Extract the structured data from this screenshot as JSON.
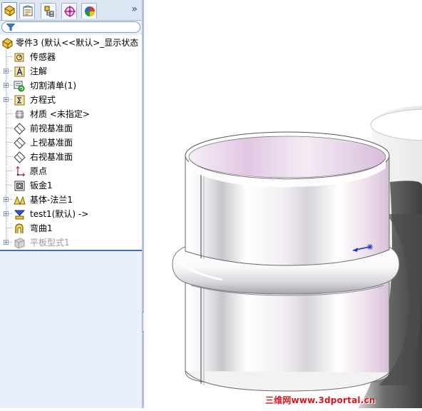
{
  "tabs": [
    {
      "icon": "feature-manager-icon",
      "active": true
    },
    {
      "icon": "property-manager-icon",
      "active": false
    },
    {
      "icon": "configuration-manager-icon",
      "active": false
    },
    {
      "icon": "dimxpert-manager-icon",
      "active": false
    },
    {
      "icon": "display-manager-icon",
      "active": false
    }
  ],
  "panel": {
    "collapse_glyph": "»",
    "filter_icon": "filter-icon"
  },
  "tree": [
    {
      "id": "root",
      "label": "零件3 (默认<<默认>_显示状态",
      "icon": "part-icon",
      "expander": ""
    },
    {
      "id": "sensors",
      "label": "传感器",
      "icon": "sensor-icon",
      "expander": ""
    },
    {
      "id": "annotations",
      "label": "注解",
      "icon": "annotation-icon",
      "expander": "+"
    },
    {
      "id": "cutlist",
      "label": "切割清单(1)",
      "icon": "cut-list-icon",
      "expander": "+"
    },
    {
      "id": "equations",
      "label": "方程式",
      "icon": "equation-icon",
      "expander": "+"
    },
    {
      "id": "material",
      "label": "材质 <未指定>",
      "icon": "material-icon",
      "expander": ""
    },
    {
      "id": "front-plane",
      "label": "前视基准面",
      "icon": "plane-icon",
      "expander": ""
    },
    {
      "id": "top-plane",
      "label": "上视基准面",
      "icon": "plane-icon",
      "expander": ""
    },
    {
      "id": "right-plane",
      "label": "右视基准面",
      "icon": "plane-icon",
      "expander": ""
    },
    {
      "id": "origin",
      "label": "原点",
      "icon": "origin-icon",
      "expander": ""
    },
    {
      "id": "sheet-metal",
      "label": "钣金1",
      "icon": "sheet-metal-icon",
      "expander": ""
    },
    {
      "id": "base-flange",
      "label": "基体-法兰1",
      "icon": "base-flange-icon",
      "expander": "+"
    },
    {
      "id": "test1",
      "label": "test1(默认) ->",
      "icon": "library-feature-icon",
      "expander": "+"
    },
    {
      "id": "bend",
      "label": "弯曲1",
      "icon": "bend-icon",
      "expander": ""
    },
    {
      "id": "flat-pattern",
      "label": "平板型式1",
      "icon": "flat-pattern-icon",
      "expander": "+",
      "suppressed": true
    }
  ],
  "viewport": {
    "watermark": "三维网www.3dportal.cn",
    "model": "sheet-metal-cylinder-with-bead"
  },
  "colors": {
    "panel": "#eaf0f9",
    "tree_bg": "#ffffff",
    "model_tint": "#e4cfe6",
    "watermark": "#d8141f"
  }
}
